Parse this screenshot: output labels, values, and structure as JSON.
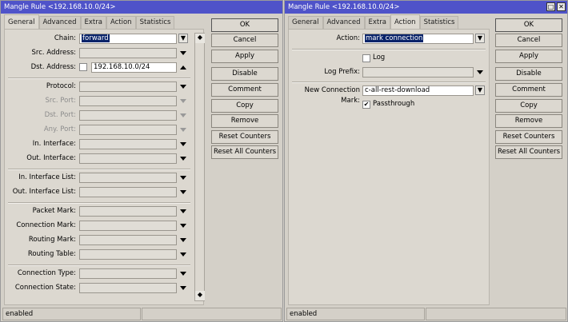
{
  "left": {
    "title": "Mangle Rule <192.168.10.0/24>",
    "tabs": [
      "General",
      "Advanced",
      "Extra",
      "Action",
      "Statistics"
    ],
    "active_tab": 0,
    "fields": [
      {
        "label": "Chain:",
        "value": "forward",
        "kind": "combo"
      },
      {
        "label": "Src. Address:",
        "value": "",
        "kind": "down"
      },
      {
        "label": "Dst. Address:",
        "value": "192.168.10.0/24",
        "kind": "up",
        "checkbox": true
      },
      {
        "sep": true
      },
      {
        "label": "Protocol:",
        "value": "",
        "kind": "down"
      },
      {
        "label": "Src. Port:",
        "value": "",
        "kind": "down",
        "disabled": true
      },
      {
        "label": "Dst. Port:",
        "value": "",
        "kind": "down",
        "disabled": true
      },
      {
        "label": "Any. Port:",
        "value": "",
        "kind": "down",
        "disabled": true
      },
      {
        "label": "In. Interface:",
        "value": "",
        "kind": "down"
      },
      {
        "label": "Out. Interface:",
        "value": "",
        "kind": "down"
      },
      {
        "sep": true
      },
      {
        "label": "In. Interface List:",
        "value": "",
        "kind": "down"
      },
      {
        "label": "Out. Interface List:",
        "value": "",
        "kind": "down"
      },
      {
        "sep": true
      },
      {
        "label": "Packet Mark:",
        "value": "",
        "kind": "down"
      },
      {
        "label": "Connection Mark:",
        "value": "",
        "kind": "down"
      },
      {
        "label": "Routing Mark:",
        "value": "",
        "kind": "down"
      },
      {
        "label": "Routing Table:",
        "value": "",
        "kind": "down"
      },
      {
        "sep": true
      },
      {
        "label": "Connection Type:",
        "value": "",
        "kind": "down"
      },
      {
        "label": "Connection State:",
        "value": "",
        "kind": "down"
      }
    ],
    "status": "enabled"
  },
  "right": {
    "title": "Mangle Rule <192.168.10.0/24>",
    "tabs": [
      "General",
      "Advanced",
      "Extra",
      "Action",
      "Statistics"
    ],
    "active_tab": 3,
    "action_label": "Action:",
    "action_value": "mark connection",
    "log_label": "Log",
    "log_checked": false,
    "log_prefix_label": "Log Prefix:",
    "log_prefix_value": "",
    "new_conn_mark_label": "New Connection Mark:",
    "new_conn_mark_value": "c-all-rest-download",
    "passthrough_label": "Passthrough",
    "passthrough_checked": true,
    "status": "enabled"
  },
  "buttons": [
    "OK",
    "Cancel",
    "Apply",
    "Disable",
    "Comment",
    "Copy",
    "Remove",
    "Reset Counters",
    "Reset All Counters"
  ],
  "window_controls": {
    "maximize": "□",
    "close": "✕"
  }
}
